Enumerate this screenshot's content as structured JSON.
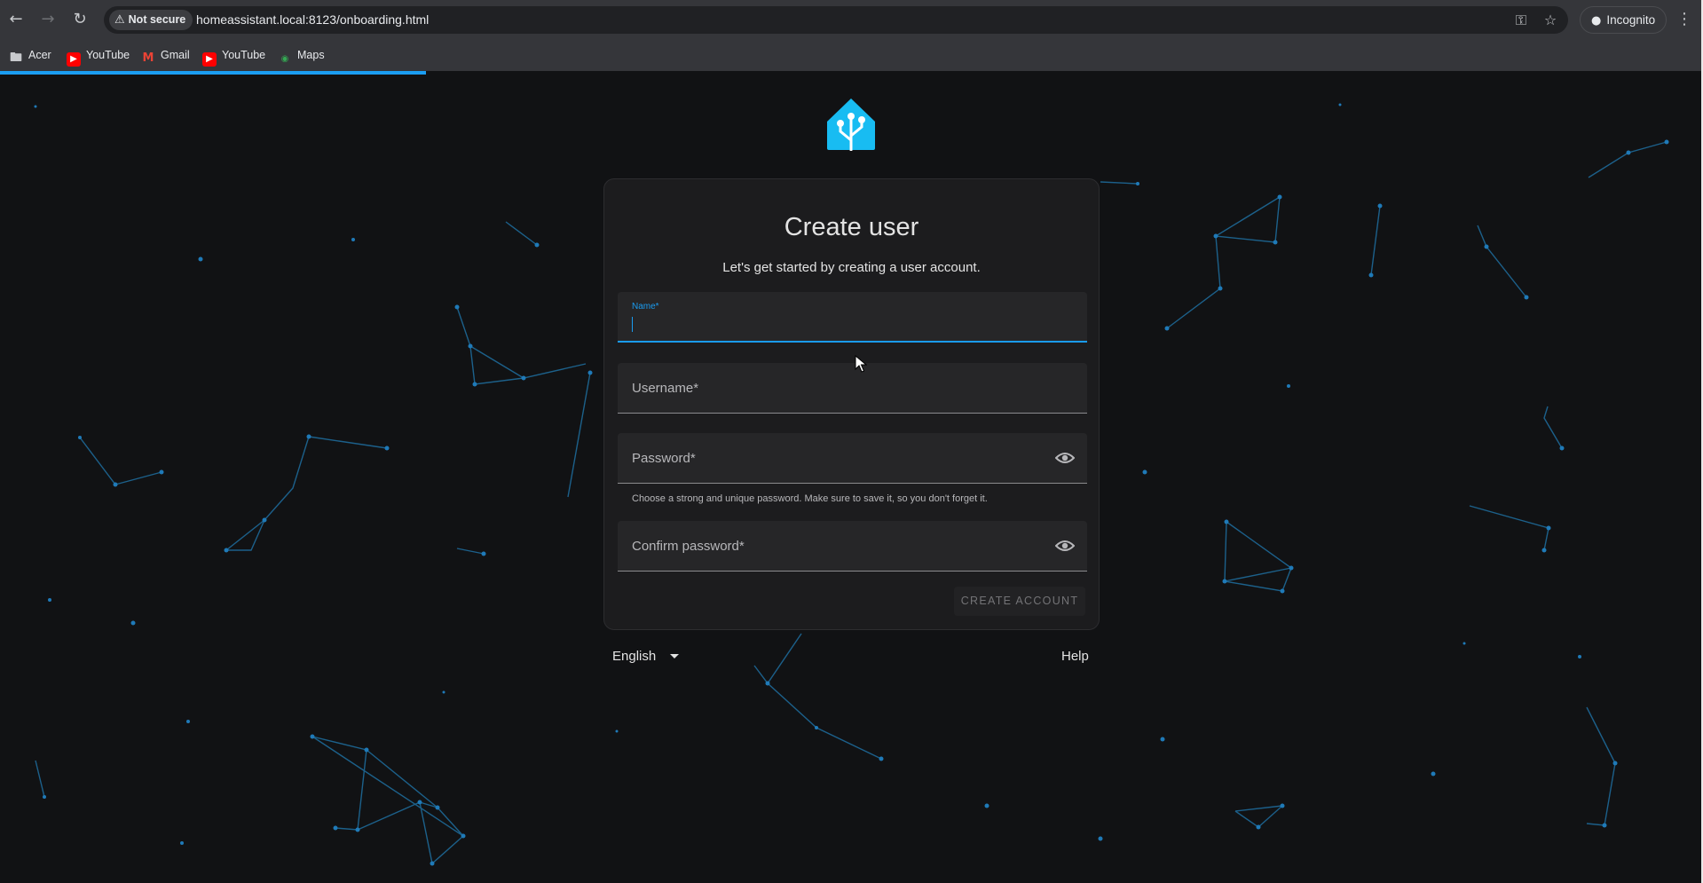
{
  "browser": {
    "security_label": "Not secure",
    "url": "homeassistant.local:8123/onboarding.html",
    "incognito_label": "Incognito",
    "bookmarks": [
      {
        "label": "Acer",
        "icon": "folder-icon"
      },
      {
        "label": "YouTube",
        "icon": "youtube-icon"
      },
      {
        "label": "Gmail",
        "icon": "gmail-icon"
      },
      {
        "label": "YouTube",
        "icon": "youtube-icon"
      },
      {
        "label": "Maps",
        "icon": "maps-icon"
      }
    ],
    "load_progress": 0.25
  },
  "card": {
    "title": "Create user",
    "subtitle": "Let's get started by creating a user account.",
    "name_label": "Name*",
    "username_label": "Username*",
    "password_label": "Password*",
    "password_hint": "Choose a strong and unique password. Make sure to save it, so you don't forget it.",
    "confirm_label": "Confirm password*",
    "create_button": "CREATE ACCOUNT"
  },
  "footer": {
    "language": "English",
    "help": "Help"
  },
  "colors": {
    "accent": "#1a9bef",
    "page_background": "#111214",
    "card_background": "#1c1c1e"
  }
}
